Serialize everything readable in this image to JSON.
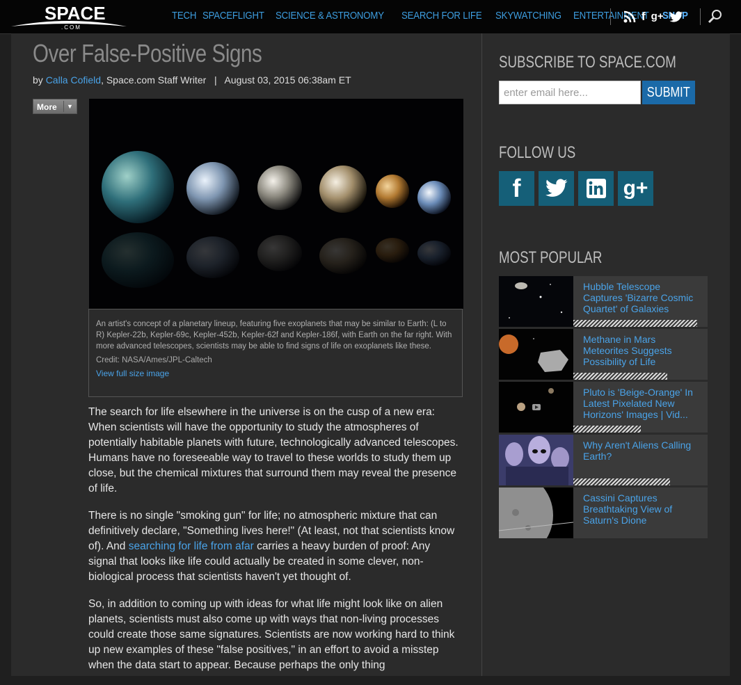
{
  "header": {
    "logo_text": "SPACE",
    "logo_sub": ".COM",
    "nav": [
      "TECH",
      "SPACEFLIGHT",
      "SCIENCE & ASTRONOMY",
      "SEARCH FOR LIFE",
      "SKYWATCHING",
      "ENTERTAINMENT",
      "SHOP"
    ],
    "social_icons": [
      "rss-icon",
      "facebook-icon",
      "google-plus-icon",
      "twitter-icon"
    ],
    "search_icon": "search-icon"
  },
  "article": {
    "headline": "Over False-Positive Signs",
    "byline_prefix": "by",
    "author": "Calla Cofield",
    "author_role": ", Space.com Staff Writer",
    "byline_sep": "|",
    "date": "August 03, 2015 06:38am ET",
    "more_label": "More",
    "image_caption": "An artist's concept of a planetary lineup, featuring five exoplanets that may be similar to Earth: (L to R) Kepler-22b, Kepler-69c, Kepler-452b, Kepler-62f and Kepler-186f, with Earth on the far right. With more advanced telescopes, scientists may be able to find signs of life on exoplanets like these.",
    "image_credit": "Credit: NASA/Ames/JPL-Caltech",
    "image_link": "View full size image",
    "p1": "The search for life elsewhere in the universe is on the cusp of a new era: When scientists will have the opportunity to study the atmospheres of potentially habitable planets with future, technologically advanced telescopes. Humans have no foreseeable way to travel to these worlds to study them up close, but the chemical mixtures that surround them may reveal the presence of life.",
    "p2_a": "There is no single \"smoking gun\" for life; no atmospheric mixture that can definitively declare, \"Something lives here!\" (At least, not that scientists know of). And ",
    "p2_link": "searching for life from afar",
    "p2_b": " carries a heavy burden of proof: Any signal that looks like life could actually be created in some clever, non-biological process that scientists haven't yet thought of.",
    "p3": "So, in addition to coming up with ideas for what life might look like on alien planets, scientists must also come up with ways that non-living processes could create those same signatures. Scientists are now working hard to think up new examples of these \"false positives,\" in an effort to avoid a misstep when the data start to appear. Because perhaps the only thing"
  },
  "sidebar": {
    "subscribe_heading": "SUBSCRIBE TO SPACE.COM",
    "email_placeholder": "enter email here...",
    "submit_label": "SUBMIT",
    "follow_heading": "FOLLOW US",
    "follow_icons": [
      "facebook-icon",
      "twitter-icon",
      "linkedin-icon",
      "google-plus-icon"
    ],
    "popular_heading": "MOST POPULAR",
    "popular": [
      {
        "title": "Hubble Telescope Captures 'Bizarre Cosmic Quartet' of Galaxies",
        "bar_frac": 0.92
      },
      {
        "title": "Methane in Mars Meteorites Suggests Possibility of Life",
        "bar_frac": 0.7
      },
      {
        "title": "Pluto is 'Beige-Orange' In Latest Pixelated New Horizons' Images | Vid...",
        "bar_frac": 0.5
      },
      {
        "title": "Why Aren't Aliens Calling Earth?",
        "bar_frac": 0.72
      },
      {
        "title": "Cassini Captures Breathtaking View of Saturn's Dione",
        "bar_frac": 0.0
      }
    ]
  }
}
